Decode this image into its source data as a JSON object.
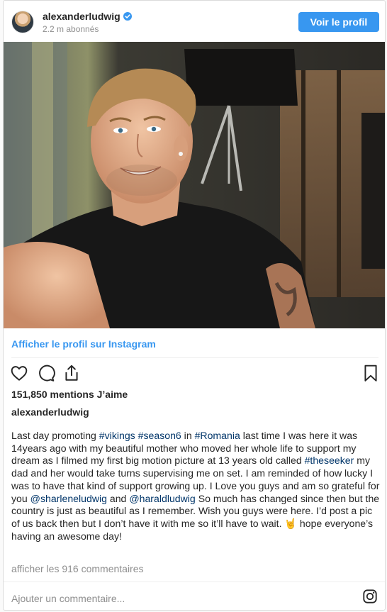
{
  "header": {
    "username": "alexanderludwig",
    "followers": "2.2 m abonnés",
    "view_profile_label": "Voir le profil"
  },
  "photo": {
    "description_icon": "selfie-photo"
  },
  "view_on_instagram": "Afficher le profil sur Instagram",
  "actions": {
    "icons": [
      "heart-icon",
      "comment-icon",
      "share-icon",
      "bookmark-icon"
    ]
  },
  "likes": "151,850 mentions J’aime",
  "author": "alexanderludwig",
  "caption": {
    "parts": [
      {
        "text": "Last day promoting ",
        "type": "text"
      },
      {
        "text": "#vikings",
        "type": "tag"
      },
      {
        "text": " ",
        "type": "text"
      },
      {
        "text": "#season6",
        "type": "tag"
      },
      {
        "text": " in ",
        "type": "text"
      },
      {
        "text": "#Romania",
        "type": "tag"
      },
      {
        "text": " last time I was here it was 14years ago with my beautiful mother who moved her whole life to support my dream as I filmed my first big motion picture at 13 years old called ",
        "type": "text"
      },
      {
        "text": "#theseeker",
        "type": "tag"
      },
      {
        "text": " my dad and her would take turns supervising me on set. I am reminded of how lucky I was to have that kind of support growing up. I Love you guys and am so grateful for you ",
        "type": "text"
      },
      {
        "text": "@sharleneludwig",
        "type": "tag"
      },
      {
        "text": " and ",
        "type": "text"
      },
      {
        "text": "@haraldludwig",
        "type": "tag"
      },
      {
        "text": " So much has changed since then but the country is just as beautiful as I remember. Wish you guys were here. I’d post a pic of us back then but I don’t have it with me so it’ll have to wait. 🤘 hope everyone’s having an awesome day!",
        "type": "text"
      }
    ]
  },
  "comments_link": "afficher les 916 commentaires",
  "add_comment_placeholder": "Ajouter un commentaire...",
  "colors": {
    "accent": "#3897f0",
    "tag": "#003569",
    "muted": "#8e8e8e"
  }
}
